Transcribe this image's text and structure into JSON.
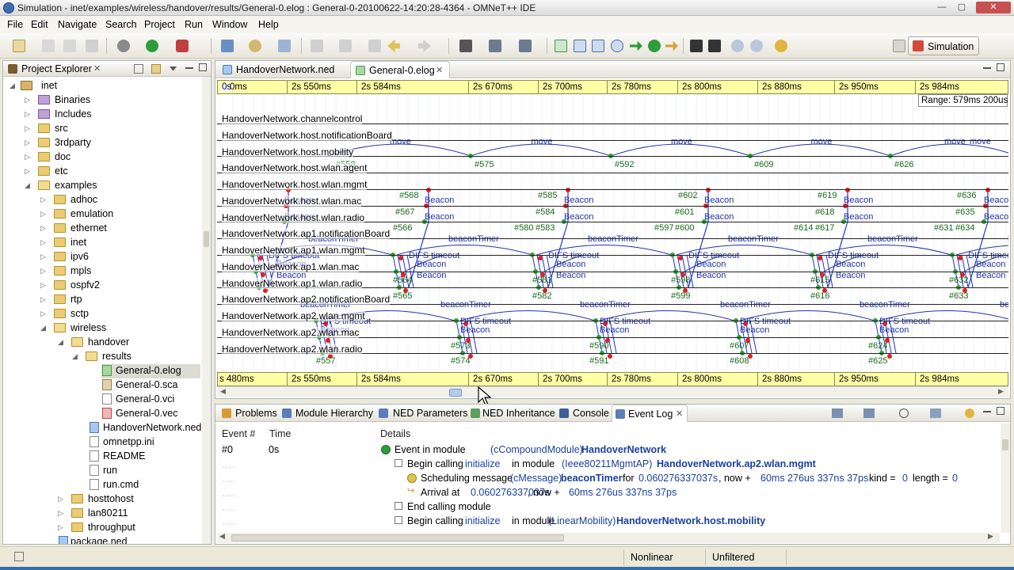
{
  "window": {
    "title": "Simulation - inet/examples/wireless/handover/results/General-0.elog : General-0-20100622-14:20:28-4364 - OMNeT++ IDE",
    "minimize": "—",
    "maximize": "▢",
    "close": "✕"
  },
  "menu": [
    "File",
    "Edit",
    "Navigate",
    "Search",
    "Project",
    "Run",
    "Window",
    "Help"
  ],
  "perspective": {
    "label": "Simulation"
  },
  "explorer": {
    "title": "Project Explorer",
    "close": "✕",
    "items": [
      {
        "label": "inet",
        "icon": "project-icon"
      },
      {
        "label": "Binaries",
        "icon": "binaries-icon"
      },
      {
        "label": "Includes",
        "icon": "includes-icon"
      },
      {
        "label": "src",
        "icon": "folder-icon"
      },
      {
        "label": "3rdparty",
        "icon": "folder-icon"
      },
      {
        "label": "doc",
        "icon": "folder-icon"
      },
      {
        "label": "etc",
        "icon": "folder-icon"
      },
      {
        "label": "examples",
        "icon": "folder-icon"
      },
      {
        "label": "adhoc",
        "icon": "folder-icon"
      },
      {
        "label": "emulation",
        "icon": "folder-icon"
      },
      {
        "label": "ethernet",
        "icon": "folder-icon"
      },
      {
        "label": "inet",
        "icon": "folder-icon"
      },
      {
        "label": "ipv6",
        "icon": "folder-icon"
      },
      {
        "label": "mpls",
        "icon": "folder-icon"
      },
      {
        "label": "ospfv2",
        "icon": "folder-icon"
      },
      {
        "label": "rtp",
        "icon": "folder-icon"
      },
      {
        "label": "sctp",
        "icon": "folder-icon"
      },
      {
        "label": "wireless",
        "icon": "folder-icon"
      },
      {
        "label": "handover",
        "icon": "folder-icon"
      },
      {
        "label": "results",
        "icon": "folder-icon"
      },
      {
        "label": "General-0.elog",
        "icon": "elog-file-icon"
      },
      {
        "label": "General-0.sca",
        "icon": "sca-file-icon"
      },
      {
        "label": "General-0.vci",
        "icon": "vci-file-icon"
      },
      {
        "label": "General-0.vec",
        "icon": "vec-file-icon"
      },
      {
        "label": "HandoverNetwork.ned",
        "icon": "ned-file-icon"
      },
      {
        "label": "omnetpp.ini",
        "icon": "ini-file-icon"
      },
      {
        "label": "README",
        "icon": "file-icon"
      },
      {
        "label": "run",
        "icon": "file-icon"
      },
      {
        "label": "run.cmd",
        "icon": "file-icon"
      },
      {
        "label": "hosttohost",
        "icon": "folder-icon"
      },
      {
        "label": "lan80211",
        "icon": "folder-icon"
      },
      {
        "label": "throughput",
        "icon": "folder-icon"
      },
      {
        "label": "package.ned",
        "icon": "ned-file-icon"
      }
    ]
  },
  "editor": {
    "tabs": [
      {
        "label": "HandoverNetwork.ned",
        "icon": "ned-file-icon"
      },
      {
        "label": "General-0.elog",
        "icon": "elog-file-icon",
        "close": "✕"
      }
    ],
    "timeline_top": [
      "0s",
      "0ms",
      "2s 550ms",
      "2s 584ms",
      "2s 670ms",
      "2s 700ms",
      "2s 780ms",
      "2s 800ms",
      "2s 880ms",
      "2s 950ms",
      "2s 984ms"
    ],
    "timeline_bottom": [
      "s 480ms",
      "2s 550ms",
      "2s 584ms",
      "2s 670ms",
      "2s 700ms",
      "2s 780ms",
      "2s 800ms",
      "2s 880ms",
      "2s 950ms",
      "2s 984ms"
    ],
    "range": "Range: 579ms 200us",
    "axes": [
      "HandoverNetwork.channelcontrol",
      "HandoverNetwork.host.notificationBoard",
      "HandoverNetwork.host.mobility",
      "HandoverNetwork.host.wlan.agent",
      "HandoverNetwork.host.wlan.mgmt",
      "HandoverNetwork.host.wlan.mac",
      "HandoverNetwork.host.wlan.radio",
      "HandoverNetwork.ap1.notificationBoard",
      "HandoverNetwork.ap1.wlan.mgmt",
      "HandoverNetwork.ap1.wlan.mac",
      "HandoverNetwork.ap1.wlan.radio",
      "HandoverNetwork.ap2.notificationBoard",
      "HandoverNetwork.ap2.wlan.mgmt",
      "HandoverNetwork.ap2.wlan.mac",
      "HandoverNetwork.ap2.wlan.radio"
    ],
    "move_labels": [
      "move",
      "move",
      "move",
      "move",
      "move",
      "move"
    ],
    "move_events": [
      "#558",
      "#575",
      "#592",
      "#609",
      "#626"
    ],
    "beacon_events": [
      [
        "#568",
        "#567",
        "#566",
        "#585",
        "#584",
        "#583",
        "#580"
      ],
      [
        "#602",
        "#601",
        "#600",
        "#597",
        "#619",
        "#618",
        "#617",
        "#614"
      ],
      [
        "#636",
        "#635",
        "#634",
        "#631"
      ]
    ],
    "ap1_events": [
      "#564",
      "#565",
      "#581",
      "#582",
      "#598",
      "#599",
      "#615",
      "#616",
      "#632",
      "#633"
    ],
    "ap2_events": [
      "#557",
      "#573",
      "#574",
      "#590",
      "#591",
      "#607",
      "#608",
      "#624",
      "#625"
    ],
    "message_names": [
      "Beacon",
      "beaconTimer",
      "DIFS timeout",
      "Beacon"
    ]
  },
  "bottom": {
    "tabs": [
      {
        "label": "Problems",
        "icon": "problems-icon"
      },
      {
        "label": "Module Hierarchy",
        "icon": "module-hierarchy-icon"
      },
      {
        "label": "NED Parameters",
        "icon": "ned-parameters-icon"
      },
      {
        "label": "NED Inheritance",
        "icon": "ned-inheritance-icon"
      },
      {
        "label": "Console",
        "icon": "console-icon"
      },
      {
        "label": "Event Log",
        "icon": "event-log-icon",
        "close": "✕"
      }
    ],
    "columns": {
      "event": "Event #",
      "time": "Time",
      "details": "Details"
    },
    "rows": {
      "r0": {
        "event": "#0",
        "time": "0s",
        "a": "Event in module",
        "b": "(cCompoundModule)",
        "c": "HandoverNetwork"
      },
      "r1": {
        "a": "Begin calling",
        "b": "initialize",
        "c": "in module",
        "d": "(Ieee80211MgmtAP)",
        "e": "HandoverNetwork.ap2.wlan.mgmt"
      },
      "r2": {
        "a": "Scheduling message",
        "b": "(cMessage)",
        "c": "beaconTimer",
        "d": "for",
        "e": "0.060276337037s",
        "f": ", now +",
        "g": "60ms 276us 337ns 37ps",
        "h": "kind =",
        "i": "0",
        "j": "length =",
        "k": "0"
      },
      "r3": {
        "a": "Arrival at",
        "b": "0.060276337037s",
        "c": ", now +",
        "d": "60ms 276us 337ns 37ps"
      },
      "r4": {
        "a": "End calling module"
      },
      "r5": {
        "a": "Begin calling",
        "b": "initialize",
        "c": "in module",
        "d": "(LinearMobility)",
        "e": "HandoverNetwork.host.mobility"
      }
    }
  },
  "status": {
    "nonlinear": "Nonlinear",
    "filter": "Unfiltered"
  }
}
